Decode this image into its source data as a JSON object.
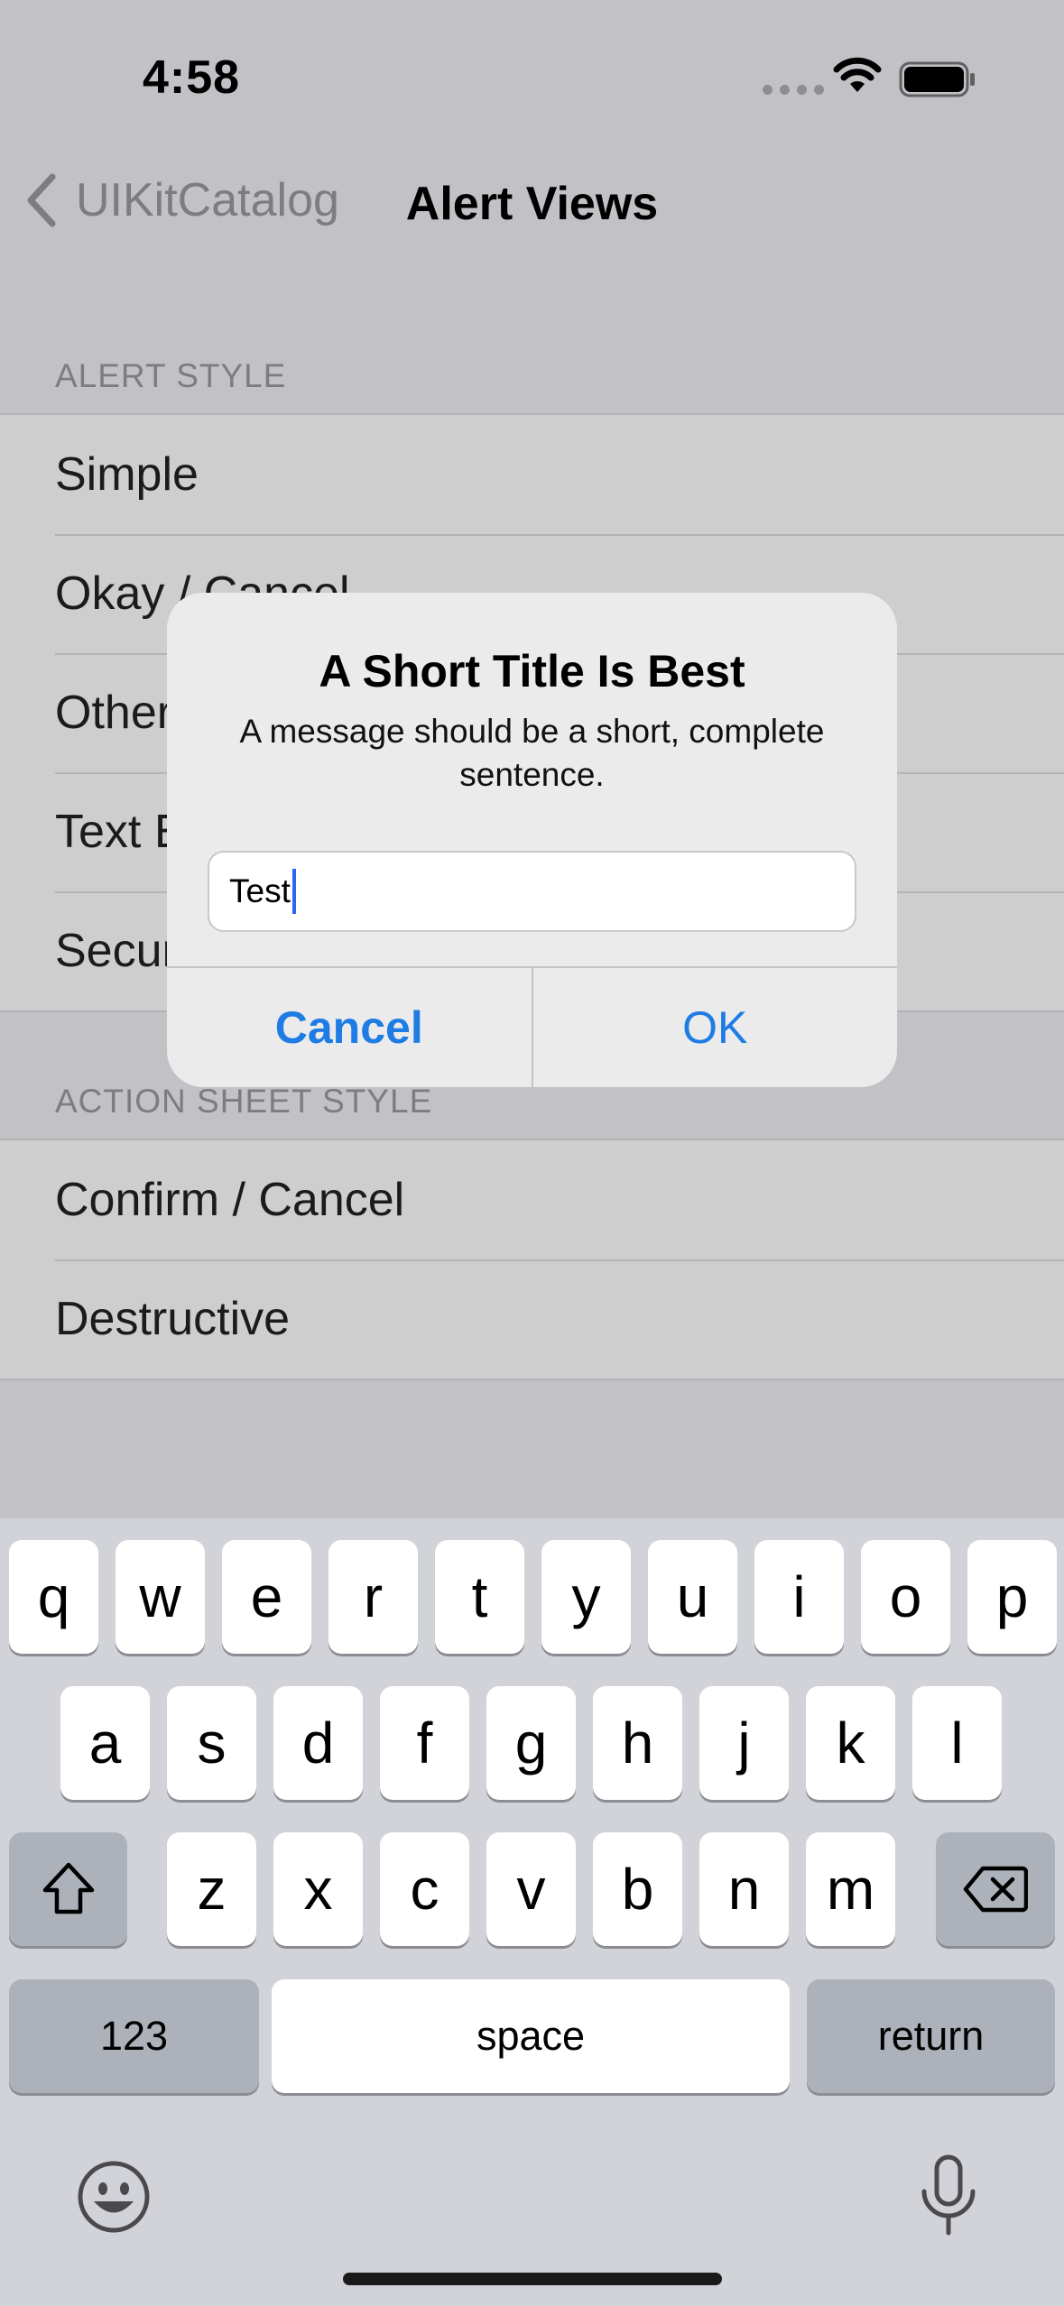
{
  "status_bar": {
    "time": "4:58"
  },
  "nav": {
    "back_label": "UIKitCatalog",
    "title": "Alert Views"
  },
  "sections": {
    "alert_style": {
      "header": "ALERT STYLE",
      "items": [
        "Simple",
        "Okay / Cancel",
        "Other",
        "Text Entry",
        "Secure Text Entry"
      ]
    },
    "action_sheet_style": {
      "header": "ACTION SHEET STYLE",
      "items": [
        "Confirm / Cancel",
        "Destructive"
      ]
    }
  },
  "alert": {
    "title": "A Short Title Is Best",
    "message": "A message should be a short, complete sentence.",
    "text_field_value": "Test",
    "cancel_label": "Cancel",
    "ok_label": "OK"
  },
  "keyboard": {
    "row1": [
      "q",
      "w",
      "e",
      "r",
      "t",
      "y",
      "u",
      "i",
      "o",
      "p"
    ],
    "row2": [
      "a",
      "s",
      "d",
      "f",
      "g",
      "h",
      "j",
      "k",
      "l"
    ],
    "row3": [
      "z",
      "x",
      "c",
      "v",
      "b",
      "n",
      "m"
    ],
    "numbers_label": "123",
    "space_label": "space",
    "return_label": "return",
    "icons": [
      "shift-icon",
      "delete-icon",
      "emoji-icon",
      "microphone-icon"
    ]
  },
  "colors": {
    "tint": "#1e7ce4",
    "caret": "#2c64f6"
  }
}
